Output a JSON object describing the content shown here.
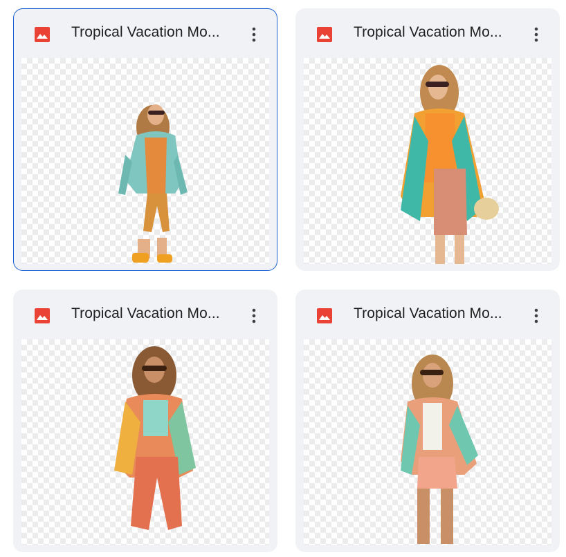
{
  "files": [
    {
      "title": "Tropical Vacation Mo...",
      "icon": "image-file-icon",
      "selected": true
    },
    {
      "title": "Tropical Vacation Mo...",
      "icon": "image-file-icon",
      "selected": false
    },
    {
      "title": "Tropical Vacation Mo...",
      "icon": "image-file-icon",
      "selected": false
    },
    {
      "title": "Tropical Vacation Mo...",
      "icon": "image-file-icon",
      "selected": false
    }
  ],
  "colors": {
    "icon_red": "#ea4335",
    "selected_border": "#1a5fd0",
    "card_bg": "#f0f2f6"
  }
}
